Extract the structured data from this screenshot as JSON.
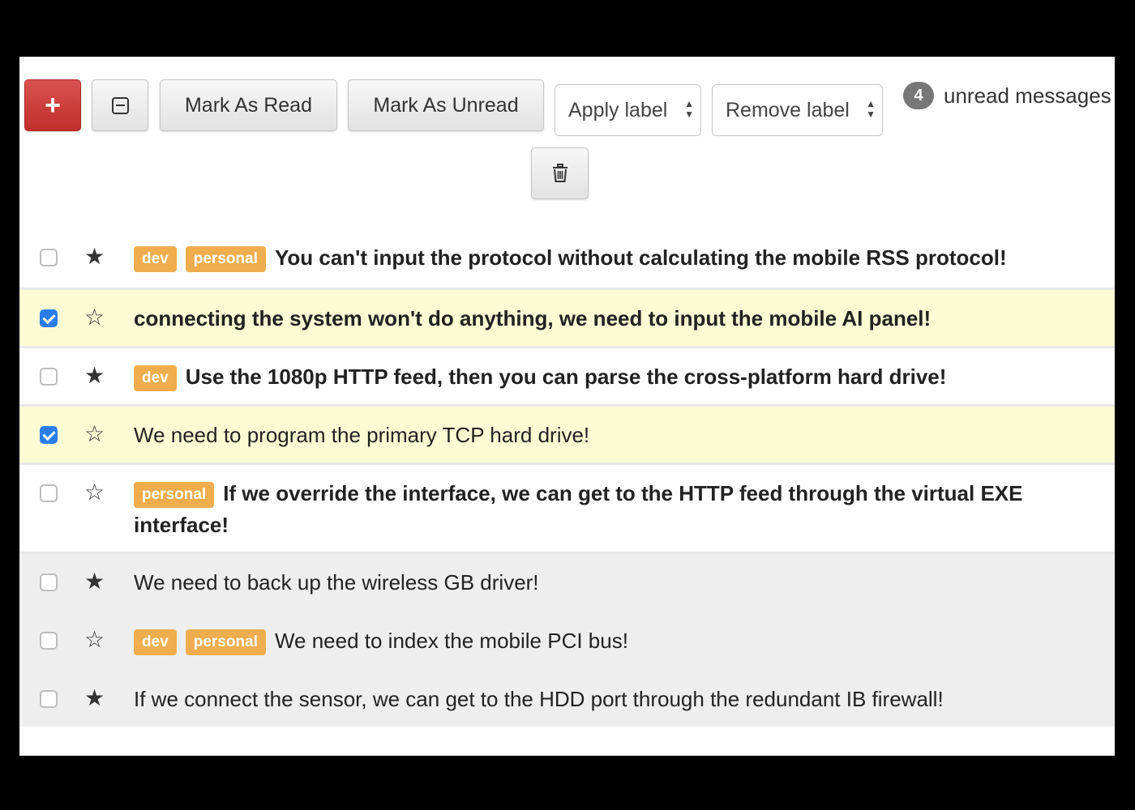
{
  "toolbar": {
    "compose_icon": "plus-icon",
    "select_icon": "minus-square-icon",
    "mark_read_label": "Mark As Read",
    "mark_unread_label": "Mark As Unread",
    "apply_label_placeholder": "Apply label",
    "remove_label_placeholder": "Remove label",
    "delete_icon": "trash-icon",
    "unread_count": "4",
    "unread_text": "unread messages"
  },
  "messages": [
    {
      "labels": [
        "dev",
        "personal"
      ],
      "subject": "You can't input the protocol without calculating the mobile RSS protocol!",
      "read": false,
      "starred": true,
      "selected": false
    },
    {
      "labels": [],
      "subject": "connecting the system won't do anything, we need to input the mobile AI panel!",
      "read": false,
      "starred": false,
      "selected": true
    },
    {
      "labels": [
        "dev"
      ],
      "subject": "Use the 1080p HTTP feed, then you can parse the cross-platform hard drive!",
      "read": false,
      "starred": true,
      "selected": false
    },
    {
      "labels": [],
      "subject": "We need to program the primary TCP hard drive!",
      "read": true,
      "starred": false,
      "selected": true
    },
    {
      "labels": [
        "personal"
      ],
      "subject": "If we override the interface, we can get to the HTTP feed through the virtual EXE interface!",
      "read": false,
      "starred": false,
      "selected": false
    },
    {
      "labels": [],
      "subject": "We need to back up the wireless GB driver!",
      "read": true,
      "starred": true,
      "selected": false
    },
    {
      "labels": [
        "dev",
        "personal"
      ],
      "subject": "We need to index the mobile PCI bus!",
      "read": true,
      "starred": false,
      "selected": false
    },
    {
      "labels": [],
      "subject": "If we connect the sensor, we can get to the HDD port through the redundant IB firewall!",
      "read": true,
      "starred": true,
      "selected": false
    }
  ],
  "colors": {
    "compose_button": "#c9302c",
    "label_badge": "#f0ad4e",
    "selected_row": "#fcfcd4",
    "read_row": "#eeeeee",
    "unread_badge": "#777777",
    "checkbox_checked": "#2b7de9"
  }
}
